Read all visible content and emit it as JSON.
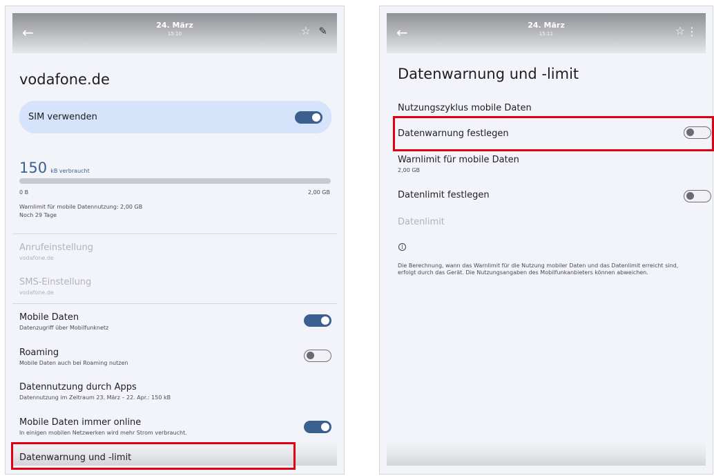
{
  "left": {
    "topbar": {
      "back_icon": "←",
      "date": "24. März",
      "time": "15:10"
    },
    "page_title": "vodafone.de",
    "sim": {
      "label": "SIM verwenden",
      "enabled": true
    },
    "usage": {
      "amount": "150",
      "unit": "kB verbraucht",
      "range_min": "0 B",
      "range_max": "2,00 GB",
      "fill_fraction": 0.0001
    },
    "warning_text": "Warnlimit für mobile Datennutzung: 2,00 GB",
    "days_left": "Noch 29 Tage",
    "rows": {
      "call_settings": {
        "title": "Anrufeinstellung",
        "sub": "vodafone.de"
      },
      "sms_settings": {
        "title": "SMS-Einstellung",
        "sub": "vodafone.de"
      },
      "mobile_data": {
        "title": "Mobile Daten",
        "sub": "Datenzugriff über Mobilfunknetz",
        "enabled": true
      },
      "roaming": {
        "title": "Roaming",
        "sub": "Mobile Daten auch bei Roaming nutzen",
        "enabled": false
      },
      "app_usage": {
        "title": "Datennutzung durch Apps",
        "sub": "Datennutzung im Zeitraum 23. März – 22. Apr.: 150 kB"
      },
      "always_online": {
        "title": "Mobile Daten immer online",
        "sub": "In einigen mobilen Netzwerken wird mehr Strom verbraucht.",
        "enabled": true
      },
      "data_warning_limit": {
        "title": "Datenwarnung und -limit"
      }
    }
  },
  "right": {
    "topbar": {
      "back_icon": "←",
      "date": "24. März",
      "time": "15:11"
    },
    "page_title": "Datenwarnung und -limit",
    "cycle": "Nutzungszyklus mobile Daten",
    "set_warning": {
      "title": "Datenwarnung festlegen",
      "enabled": false
    },
    "warning_limit": {
      "title": "Warnlimit für mobile Daten",
      "value": "2,00 GB"
    },
    "set_limit": {
      "title": "Datenlimit festlegen",
      "enabled": false
    },
    "data_limit": "Datenlimit",
    "info_icon": "i",
    "info_line1": "Die Berechnung, wann das Warnlimit für die Nutzung mobiler Daten und das Datenlimit erreicht sind,",
    "info_line2": "erfolgt durch das Gerät. Die Nutzungsangaben des Mobilfunkanbieters können abweichen."
  },
  "colors": {
    "highlight": "#e0000f",
    "toggle_on": "#3b5f8f",
    "sim_card": "#d5e3fb",
    "background": "#f3f4f9"
  }
}
